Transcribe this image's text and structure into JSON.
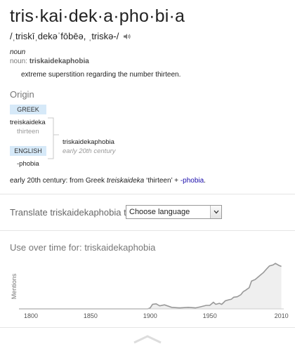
{
  "entry": {
    "headword": "tris·kai·dek·a·pho·bi·a",
    "pronunciation": "/ˌtriskīˌdekəˈfōbēə, ˌtriskə-/",
    "part_of_speech": "noun",
    "noun_label": "noun:",
    "noun_term": "triskaidekaphobia",
    "definition": "extreme superstition regarding the number thirteen."
  },
  "origin": {
    "title": "Origin",
    "lang1": "GREEK",
    "word1": "treiskaideka",
    "gloss1": "thirteen",
    "lang2": "ENGLISH",
    "word2": "-phobia",
    "result_word": "triskaidekaphobia",
    "result_date": "early 20th century",
    "note_prefix": "early 20th century: from Greek ",
    "note_italic": "treiskaideka",
    "note_mid": " ‘thirteen’ + ",
    "note_link": "-phobia",
    "note_suffix": "."
  },
  "translate": {
    "label": "Translate triskaidekaphobia to",
    "select_value": "Choose language"
  },
  "usage": {
    "title": "Use over time for: triskaidekaphobia"
  },
  "chart_data": {
    "type": "area",
    "ylabel": "Mentions",
    "xticks": [
      1800,
      1850,
      1900,
      1950,
      2010
    ],
    "xlim": [
      1790,
      2012
    ],
    "ylim": [
      0,
      100
    ],
    "x": [
      1790,
      1898,
      1900,
      1902,
      1905,
      1908,
      1912,
      1918,
      1925,
      1932,
      1938,
      1942,
      1947,
      1950,
      1953,
      1955,
      1958,
      1960,
      1963,
      1966,
      1968,
      1970,
      1973,
      1976,
      1978,
      1980,
      1983,
      1985,
      1988,
      1990,
      1993,
      1995,
      1998,
      2000,
      2003,
      2005,
      2008,
      2010
    ],
    "y": [
      0,
      0,
      2,
      9,
      10,
      6,
      8,
      3,
      2,
      3,
      2,
      4,
      7,
      7,
      13,
      9,
      11,
      9,
      16,
      18,
      19,
      23,
      24,
      28,
      34,
      37,
      42,
      55,
      58,
      62,
      68,
      72,
      80,
      85,
      87,
      90,
      86,
      84
    ],
    "colors": {
      "fill": "#efefef",
      "line": "#999999",
      "axis": "#cccccc"
    }
  }
}
